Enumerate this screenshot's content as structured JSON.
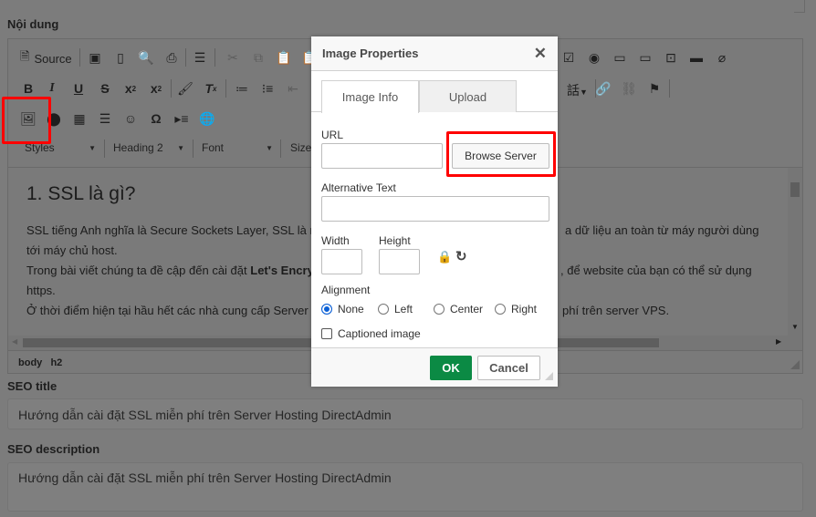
{
  "page": {
    "content_label": "Nội dung",
    "seo_title_label": "SEO title",
    "seo_title_value": "Hướng dẫn cài đặt SSL miễn phí trên Server Hosting DirectAdmin",
    "seo_description_label": "SEO description",
    "seo_description_value": "Hướng dẫn cài đặt SSL miễn phí trên Server Hosting DirectAdmin"
  },
  "toolbar": {
    "source_label": "Source",
    "styles": "Styles",
    "format": "Heading 2",
    "font": "Font",
    "size": "Size",
    "language_glyph": "話"
  },
  "content": {
    "heading": "1. SSL là gì?",
    "line1_left": "SSL tiếng Anh nghĩa là Secure Sockets Layer, SSL là r",
    "line1_right": "a dữ liệu an toàn từ máy người dùng",
    "line2": "tới máy chủ host.",
    "line3_left": "Trong bài viết chúng ta đề cập đến cài đặt ",
    "line3_bold": "Let's Encry",
    "line3_right": ", để website của bạn có thể sử dụng",
    "line4": "https.",
    "line5_left": "Ở thời điểm hiện tại hầu hết các nhà cung cấp Server",
    "line5_right": "phí trên server VPS."
  },
  "path": {
    "body": "body",
    "h2": "h2"
  },
  "dialog": {
    "title": "Image Properties",
    "tabs": [
      "Image Info",
      "Upload"
    ],
    "url_label": "URL",
    "url_value": "",
    "browse_label": "Browse Server",
    "alt_label": "Alternative Text",
    "alt_value": "",
    "width_label": "Width",
    "height_label": "Height",
    "alignment_label": "Alignment",
    "alignment_options": [
      "None",
      "Left",
      "Center",
      "Right"
    ],
    "alignment_selected": "None",
    "captioned_label": "Captioned image",
    "captioned_checked": false,
    "ok_label": "OK",
    "cancel_label": "Cancel",
    "ok_color": "#0b8a44"
  },
  "highlight_color": "#ff0000"
}
